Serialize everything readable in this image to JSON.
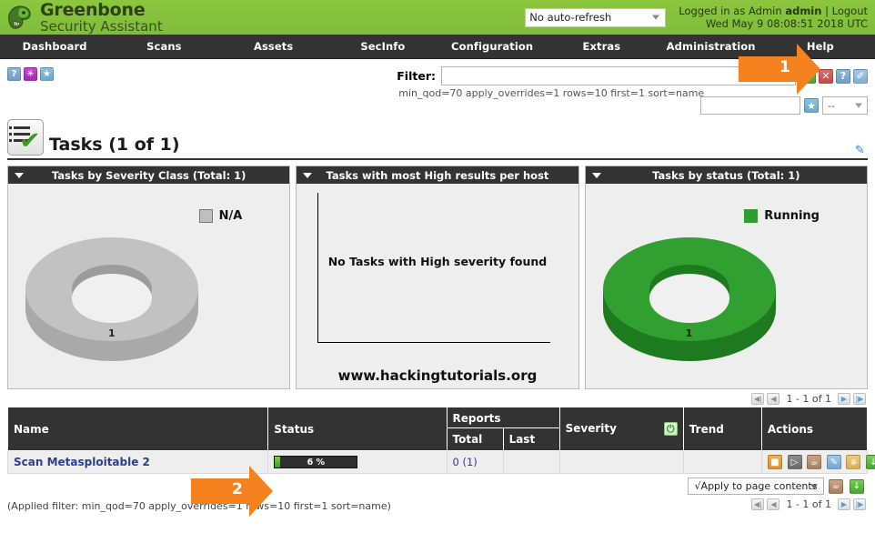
{
  "header": {
    "brand_line1": "Greenbone",
    "brand_line2": "Security Assistant",
    "dragon_icon": "dragon-logo-icon",
    "refresh_select_value": "No auto-refresh",
    "logged_in_prefix": "Logged in as",
    "role": "Admin",
    "username": "admin",
    "separator": "|",
    "logout_label": "Logout",
    "datetime": "Wed May 9 08:08:51 2018 UTC"
  },
  "nav": {
    "items": [
      {
        "label": "Dashboard"
      },
      {
        "label": "Scans"
      },
      {
        "label": "Assets"
      },
      {
        "label": "SecInfo"
      },
      {
        "label": "Configuration"
      },
      {
        "label": "Extras"
      },
      {
        "label": "Administration"
      },
      {
        "label": "Help"
      }
    ]
  },
  "toolbar": {
    "left_icons": [
      {
        "name": "help-icon",
        "glyph": "?"
      },
      {
        "name": "wizard-icon",
        "glyph": "✳"
      },
      {
        "name": "star-icon",
        "glyph": "★"
      }
    ],
    "filter_label": "Filter:",
    "filter_value": "",
    "filter_description": "min_qod=70 apply_overrides=1 rows=10 first=1 sort=name",
    "buttons": [
      {
        "name": "refresh-filter-icon",
        "glyph": "↻"
      },
      {
        "name": "reset-filter-icon",
        "glyph": "✕"
      },
      {
        "name": "filter-help-icon",
        "glyph": "?"
      },
      {
        "name": "edit-filter-icon",
        "glyph": "✐"
      }
    ],
    "filter_name_value": "",
    "save-filter-icon": "★",
    "filter_select_value": "--"
  },
  "page": {
    "title": "Tasks (1 of 1)",
    "title_icon": "tasks-list-icon",
    "edit_dashboard_icon": "edit-dashboard-icon"
  },
  "dashboard": {
    "cards": [
      {
        "title": "Tasks by Severity Class (Total: 1)",
        "collapse_icon": "chevron-down-icon",
        "legend": [
          {
            "label": "N/A",
            "color": "#bfbfbf"
          }
        ],
        "value_label": "1"
      },
      {
        "title": "Tasks with most High results per host",
        "collapse_icon": "chevron-down-icon",
        "empty_message": "No Tasks with High severity found",
        "watermark": "www.hackingtutorials.org"
      },
      {
        "title": "Tasks by status (Total: 1)",
        "collapse_icon": "chevron-down-icon",
        "legend": [
          {
            "label": "Running",
            "color": "#2f9e2f"
          }
        ],
        "value_label": "1"
      }
    ]
  },
  "chart_data": [
    {
      "type": "pie",
      "title": "Tasks by Severity Class (Total: 1)",
      "labels": [
        "N/A"
      ],
      "values": [
        1
      ],
      "colors": [
        "#bfbfbf"
      ],
      "legend_position": "top-right",
      "donut": true,
      "data_labels": [
        "1"
      ]
    },
    {
      "type": "bar",
      "title": "Tasks with most High results per host",
      "categories": [],
      "values": [],
      "xlabel": "",
      "ylabel": "",
      "annotation": "No Tasks with High severity found",
      "grid": false
    },
    {
      "type": "pie",
      "title": "Tasks by status (Total: 1)",
      "labels": [
        "Running"
      ],
      "values": [
        1
      ],
      "colors": [
        "#2f9e2f"
      ],
      "legend_position": "top-right",
      "donut": true,
      "data_labels": [
        "1"
      ]
    }
  ],
  "pagination": {
    "first_icon": "first-page-icon",
    "prev_icon": "prev-page-icon",
    "range_text": "1 - 1 of 1",
    "next_icon": "next-page-icon",
    "last_icon": "last-page-icon"
  },
  "table": {
    "headers": {
      "name": "Name",
      "status": "Status",
      "reports": "Reports",
      "reports_total": "Total",
      "reports_last": "Last",
      "severity": "Severity",
      "severity_icon": "power-toggle-icon",
      "trend": "Trend",
      "actions": "Actions"
    },
    "rows": [
      {
        "name": "Scan Metasploitable 2",
        "status_percent": "6 %",
        "status_value": 6,
        "reports_total": "0 (1)",
        "reports_last": "",
        "severity": "",
        "trend": "",
        "actions": [
          {
            "name": "stop-task-icon",
            "glyph": "■"
          },
          {
            "name": "resume-task-icon",
            "glyph": "▶"
          },
          {
            "name": "delete-task-icon",
            "glyph": "Ὕ1"
          },
          {
            "name": "edit-task-icon",
            "glyph": "✐"
          },
          {
            "name": "clone-task-icon",
            "glyph": "❐"
          },
          {
            "name": "export-task-icon",
            "glyph": "↓"
          }
        ]
      }
    ],
    "apply_to_page_label": "√Apply to page contents",
    "bulk_actions": [
      {
        "name": "bulk-delete-icon",
        "glyph": "Ὕ1"
      },
      {
        "name": "bulk-export-icon",
        "glyph": "↓"
      }
    ]
  },
  "footer": {
    "applied_filter": "(Applied filter: min_qod=70 apply_overrides=1 rows=10 first=1 sort=name)"
  },
  "callouts": [
    {
      "number": "1"
    },
    {
      "number": "2"
    }
  ]
}
